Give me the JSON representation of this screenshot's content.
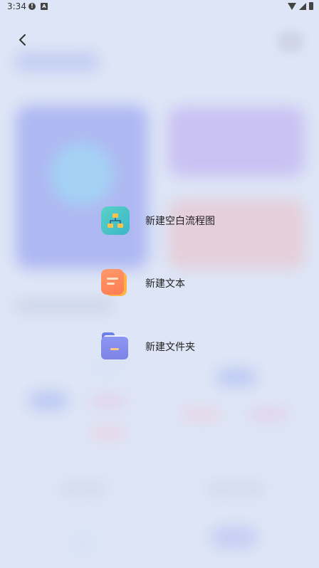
{
  "status_bar": {
    "time": "3:34",
    "alert_glyph": "!",
    "a_glyph": "A"
  },
  "menu": {
    "items": [
      {
        "label": "新建空白流程图",
        "icon": "flowchart-icon",
        "color": "#3cb6c9"
      },
      {
        "label": "新建文本",
        "icon": "document-icon",
        "color": "#ff8a5a"
      },
      {
        "label": "新建文件夹",
        "icon": "folder-icon",
        "color": "#7b84e6"
      }
    ]
  },
  "colors": {
    "background": "#dde5f6",
    "text": "#222222"
  }
}
